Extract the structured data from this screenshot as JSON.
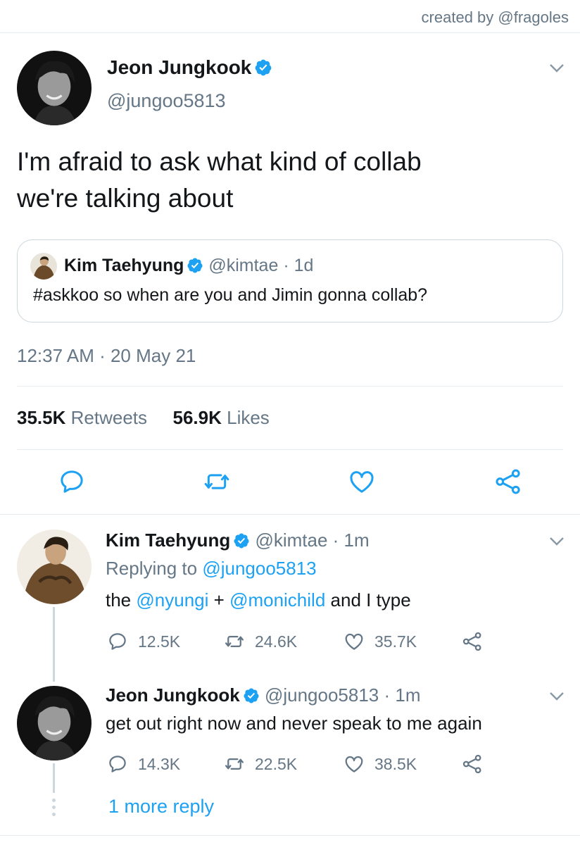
{
  "credit": "created by @fragoles",
  "colors": {
    "accent": "#1da1f2",
    "text": "#14171a",
    "muted": "#657786",
    "border": "#e6ecf0"
  },
  "main_tweet": {
    "name": "Jeon Jungkook",
    "handle": "@jungoo5813",
    "text_line1": "I'm afraid to ask what kind of collab",
    "text_line2": "we're talking about",
    "quoted": {
      "name": "Kim Taehyung",
      "handle": "@kimtae",
      "time": "· 1d",
      "text": "#askkoo so when are you and Jimin gonna collab?"
    },
    "timestamp": "12:37 AM · 20 May 21",
    "retweets_count": "35.5K",
    "retweets_label": "Retweets",
    "likes_count": "56.9K",
    "likes_label": "Likes",
    "icons": [
      "reply-icon",
      "retweet-icon",
      "like-icon",
      "share-icon"
    ]
  },
  "replies": [
    {
      "name": "Kim Taehyung",
      "handle": "@kimtae",
      "time": "· 1m",
      "replying_prefix": "Replying to",
      "replying_to": "@jungoo5813",
      "text_start": "the",
      "mention1": "@nyungi",
      "plus": "+",
      "mention2": "@monichild",
      "text_end": "and I type",
      "reply_count": "12.5K",
      "retweet_count": "24.6K",
      "like_count": "35.7K"
    },
    {
      "name": "Jeon Jungkook",
      "handle": "@jungoo5813",
      "time": "· 1m",
      "text": "get out right now and never speak to me again",
      "reply_count": "14.3K",
      "retweet_count": "22.5K",
      "like_count": "38.5K"
    }
  ],
  "more_replies": "1 more reply"
}
